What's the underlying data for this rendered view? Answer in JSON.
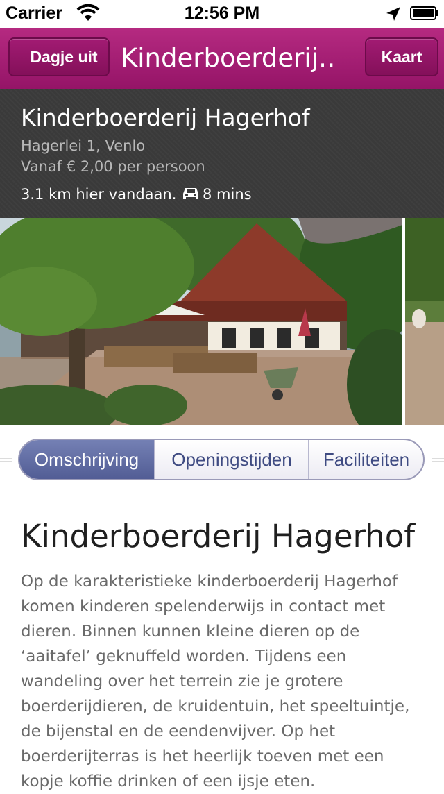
{
  "status_bar": {
    "carrier": "Carrier",
    "time": "12:56 PM"
  },
  "nav": {
    "back_label": "Dagje uit",
    "title": "Kinderboerderij…",
    "map_label": "Kaart"
  },
  "info": {
    "name": "Kinderboerderij Hagerhof",
    "address": "Hagerlei 1, Venlo",
    "price": "Vanaf € 2,00 per persoon",
    "distance": "3.1 km hier vandaan.",
    "travel_time": "8 mins"
  },
  "tabs": [
    {
      "label": "Omschrijving",
      "active": true
    },
    {
      "label": "Openingstijden",
      "active": false
    },
    {
      "label": "Faciliteiten",
      "active": false
    }
  ],
  "content": {
    "title": "Kinderboerderij Hagerhof",
    "description": "Op de karakteristieke kinderboerderij Hagerhof komen kinderen spelenderwijs in contact met dieren. Binnen kunnen kleine dieren op de ‘aaitafel’ geknuffeld worden. Tijdens een wandeling over het terrein zie je grotere boerderijdieren, de kruidentuin, het speeltuintje, de bijenstal en de eendenvijver. Op het boerderijterras is het heerlijk toeven met een kopje koffie drinken of een ijsje eten."
  },
  "colors": {
    "nav": "#a21b73",
    "tab_active": "#5a659c",
    "info_bg": "#3a3a3a"
  },
  "icons": [
    "wifi-icon",
    "location-arrow-icon",
    "battery-icon",
    "back-chevron-icon",
    "car-icon"
  ]
}
